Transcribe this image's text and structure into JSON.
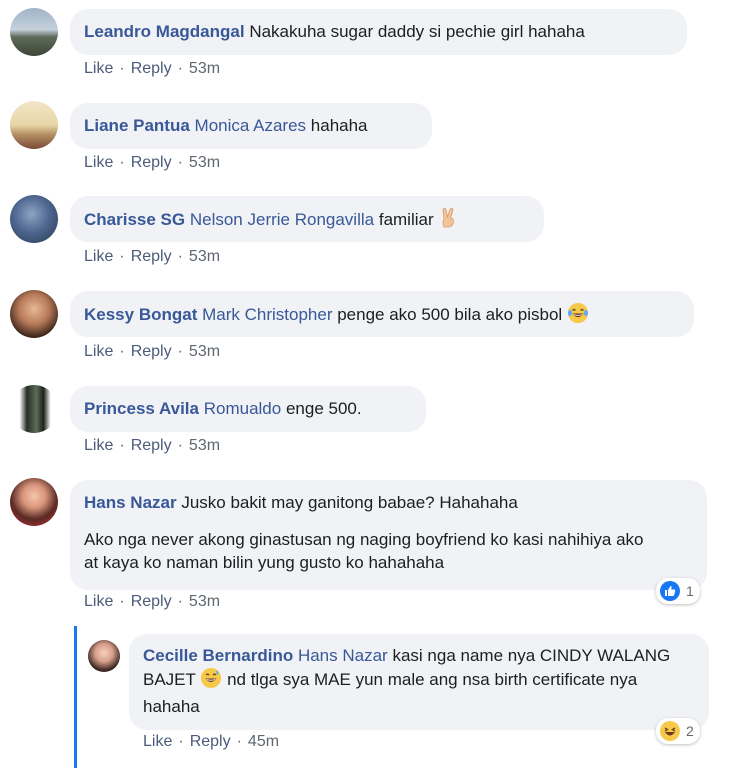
{
  "comments": [
    {
      "author": "Leandro Magdangal",
      "mention": "",
      "text": "Nakakuha sugar daddy si pechie girl hahaha",
      "like": "Like",
      "reply": "Reply",
      "time": "53m"
    },
    {
      "author": "Liane Pantua",
      "mention": "Monica Azares",
      "text": "hahaha",
      "like": "Like",
      "reply": "Reply",
      "time": "53m"
    },
    {
      "author": "Charisse SG",
      "mention": "Nelson Jerrie Rongavilla",
      "text": "familiar",
      "emoji": "victory-hand",
      "like": "Like",
      "reply": "Reply",
      "time": "53m"
    },
    {
      "author": "Kessy Bongat",
      "mention": "Mark Christopher",
      "text": "penge ako 500 bila ako pisbol",
      "emoji": "tears-of-joy",
      "like": "Like",
      "reply": "Reply",
      "time": "53m"
    },
    {
      "author": "Princess Avila",
      "mention": "Romualdo",
      "text": "enge 500.",
      "like": "Like",
      "reply": "Reply",
      "time": "53m"
    },
    {
      "author": "Hans Nazar",
      "mention": "",
      "text": "Jusko bakit may ganitong babae? Hahahaha",
      "text2": "Ako nga never akong ginastusan ng naging boyfriend ko kasi nahihiya ako at kaya ko naman bilin yung gusto ko hahahaha",
      "reaction": {
        "type": "like",
        "count": "1"
      },
      "like": "Like",
      "reply": "Reply",
      "time": "53m"
    }
  ],
  "reply": {
    "author": "Cecille Bernardino",
    "mention": "Hans Nazar",
    "text_a": "kasi nga name nya CINDY WALANG BAJET",
    "text_b": "nd tlga sya MAE yun male ang nsa birth certificate nya hahaha",
    "emoji": "grinning-sweat",
    "reaction": {
      "type": "haha",
      "count": "2"
    },
    "like": "Like",
    "reply": "Reply",
    "time": "45m"
  },
  "colors": {
    "author": "#385898",
    "bubble": "#f0f2f5",
    "thread_line": "#1877f2"
  }
}
